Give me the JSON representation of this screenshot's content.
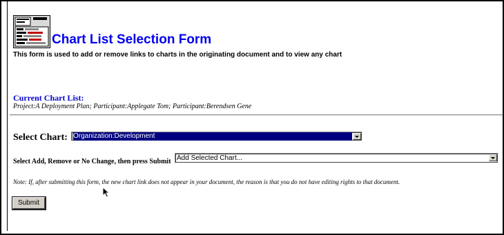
{
  "header": {
    "title": "Chart List Selection Form",
    "subtitle": "This form is used to add or remove links to charts in the originating document and to view any chart"
  },
  "current_chart_list": {
    "heading": "Current Chart List:",
    "items_text": "Project:A Deployment Plan; Participant:Applegate Tom; Participant:Berendsen Gene"
  },
  "select_chart": {
    "label": "Select Chart:",
    "selected_value": "Organization:Development"
  },
  "action": {
    "label": "Select Add, Remove or No Change, then press Submit",
    "selected_value": "Add Selected Chart..."
  },
  "note": "Note: If, after submitting this form, the new chart link does not appear in your document, the reason is that you do not have editing rights to that document.",
  "submit_label": "Submit",
  "colors": {
    "title_blue": "#0000ee",
    "heading_blue": "#0000cc",
    "selection_navy": "#000080",
    "button_face": "#d4d0c8"
  }
}
